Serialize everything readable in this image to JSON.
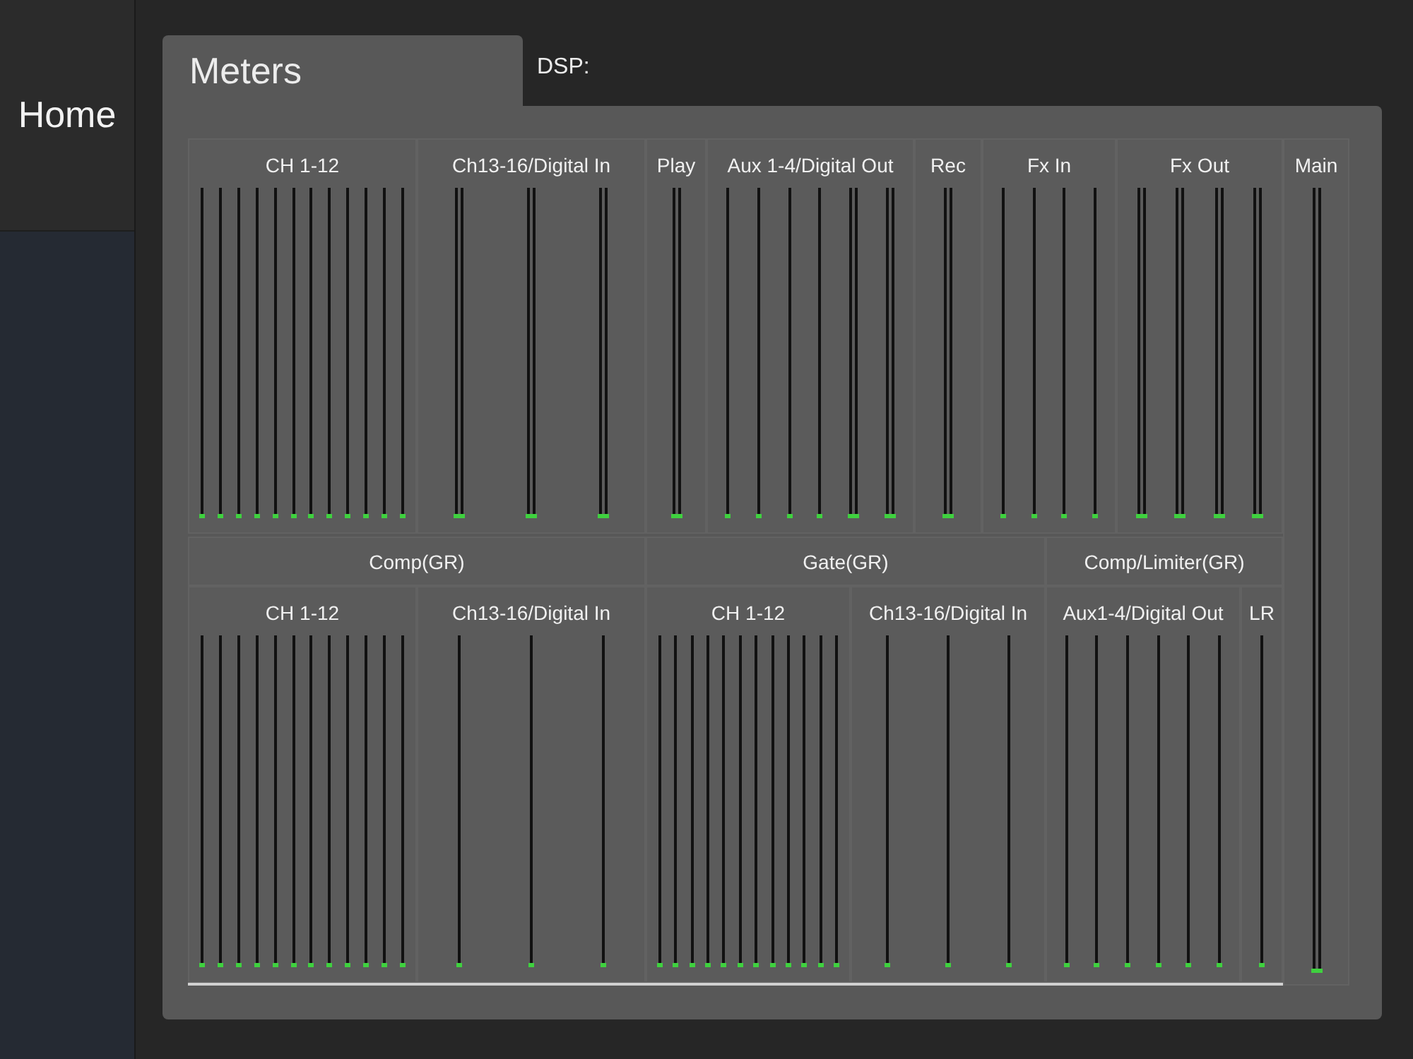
{
  "sidebar": {
    "items": [
      {
        "label": "Home",
        "selected": true
      }
    ]
  },
  "tabs": [
    {
      "label": "Meters",
      "selected": true
    },
    {
      "label": "DSP:",
      "selected": false
    }
  ],
  "top_groups": [
    {
      "title": "CH 1-12",
      "meters": [
        {
          "kind": "mono",
          "level": 0
        },
        {
          "kind": "mono",
          "level": 0
        },
        {
          "kind": "mono",
          "level": 0
        },
        {
          "kind": "mono",
          "level": 0
        },
        {
          "kind": "mono",
          "level": 0
        },
        {
          "kind": "mono",
          "level": 0
        },
        {
          "kind": "mono",
          "level": 0
        },
        {
          "kind": "mono",
          "level": 0
        },
        {
          "kind": "mono",
          "level": 0
        },
        {
          "kind": "mono",
          "level": 0
        },
        {
          "kind": "mono",
          "level": 0
        },
        {
          "kind": "mono",
          "level": 0
        }
      ]
    },
    {
      "title": "Ch13-16/Digital In",
      "meters": [
        {
          "kind": "stereo",
          "level": 0
        },
        {
          "kind": "stereo",
          "level": 0
        },
        {
          "kind": "stereo",
          "level": 0
        }
      ]
    },
    {
      "title": "Play",
      "meters": [
        {
          "kind": "stereo",
          "level": 0
        }
      ]
    },
    {
      "title": "Aux 1-4/Digital Out",
      "meters": [
        {
          "kind": "mono",
          "level": 0
        },
        {
          "kind": "mono",
          "level": 0
        },
        {
          "kind": "mono",
          "level": 0
        },
        {
          "kind": "mono",
          "level": 0
        },
        {
          "kind": "stereo",
          "level": 0
        },
        {
          "kind": "stereo",
          "level": 0
        }
      ]
    },
    {
      "title": "Rec",
      "meters": [
        {
          "kind": "stereo",
          "level": 0
        }
      ]
    },
    {
      "title": "Fx In",
      "meters": [
        {
          "kind": "mono",
          "level": 0
        },
        {
          "kind": "mono",
          "level": 0
        },
        {
          "kind": "mono",
          "level": 0
        },
        {
          "kind": "mono",
          "level": 0
        }
      ]
    },
    {
      "title": "Fx Out",
      "meters": [
        {
          "kind": "stereo",
          "level": 0
        },
        {
          "kind": "stereo",
          "level": 0
        },
        {
          "kind": "stereo",
          "level": 0
        },
        {
          "kind": "stereo",
          "level": 0
        }
      ]
    }
  ],
  "main": {
    "title": "Main",
    "meters": [
      {
        "kind": "stereo",
        "level": 0
      }
    ]
  },
  "bottom_sections": [
    {
      "title": "Comp(GR)",
      "groups": [
        {
          "title": "CH 1-12",
          "meters": [
            {
              "kind": "mono",
              "level": 0
            },
            {
              "kind": "mono",
              "level": 0
            },
            {
              "kind": "mono",
              "level": 0
            },
            {
              "kind": "mono",
              "level": 0
            },
            {
              "kind": "mono",
              "level": 0
            },
            {
              "kind": "mono",
              "level": 0
            },
            {
              "kind": "mono",
              "level": 0
            },
            {
              "kind": "mono",
              "level": 0
            },
            {
              "kind": "mono",
              "level": 0
            },
            {
              "kind": "mono",
              "level": 0
            },
            {
              "kind": "mono",
              "level": 0
            },
            {
              "kind": "mono",
              "level": 0
            }
          ]
        },
        {
          "title": "Ch13-16/Digital In",
          "meters": [
            {
              "kind": "mono",
              "level": 0
            },
            {
              "kind": "mono",
              "level": 0
            },
            {
              "kind": "mono",
              "level": 0
            }
          ]
        }
      ]
    },
    {
      "title": "Gate(GR)",
      "groups": [
        {
          "title": "CH 1-12",
          "meters": [
            {
              "kind": "mono",
              "level": 0
            },
            {
              "kind": "mono",
              "level": 0
            },
            {
              "kind": "mono",
              "level": 0
            },
            {
              "kind": "mono",
              "level": 0
            },
            {
              "kind": "mono",
              "level": 0
            },
            {
              "kind": "mono",
              "level": 0
            },
            {
              "kind": "mono",
              "level": 0
            },
            {
              "kind": "mono",
              "level": 0
            },
            {
              "kind": "mono",
              "level": 0
            },
            {
              "kind": "mono",
              "level": 0
            },
            {
              "kind": "mono",
              "level": 0
            },
            {
              "kind": "mono",
              "level": 0
            }
          ]
        },
        {
          "title": "Ch13-16/Digital In",
          "meters": [
            {
              "kind": "mono",
              "level": 0
            },
            {
              "kind": "mono",
              "level": 0
            },
            {
              "kind": "mono",
              "level": 0
            }
          ]
        }
      ]
    },
    {
      "title": "Comp/Limiter(GR)",
      "groups": [
        {
          "title": "Aux1-4/Digital Out",
          "meters": [
            {
              "kind": "mono",
              "level": 0
            },
            {
              "kind": "mono",
              "level": 0
            },
            {
              "kind": "mono",
              "level": 0
            },
            {
              "kind": "mono",
              "level": 0
            },
            {
              "kind": "mono",
              "level": 0
            },
            {
              "kind": "mono",
              "level": 0
            }
          ]
        },
        {
          "title": "LR",
          "meters": [
            {
              "kind": "mono",
              "level": 0
            }
          ]
        }
      ]
    }
  ]
}
